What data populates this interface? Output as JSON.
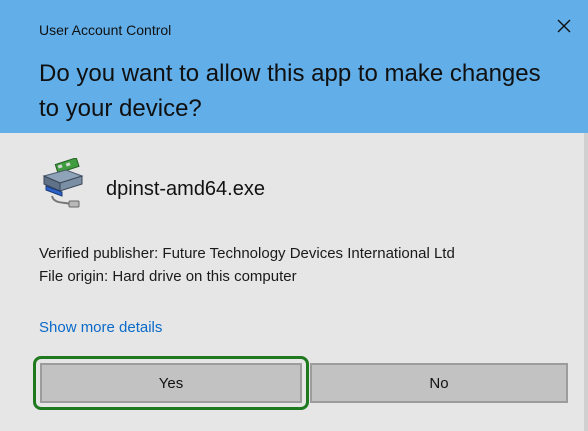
{
  "window": {
    "title": "User Account Control",
    "close_icon": "close-icon"
  },
  "prompt": {
    "text": "Do you want to allow this app to make changes to your device?"
  },
  "app": {
    "icon": "installer-icon",
    "name": "dpinst-amd64.exe"
  },
  "details": {
    "publisher": "Verified publisher: Future Technology Devices International Ltd",
    "origin": "File origin: Hard drive on this computer",
    "show_more": "Show more details"
  },
  "buttons": {
    "yes": "Yes",
    "no": "No"
  },
  "colors": {
    "header": "#61aee8",
    "body": "#e6e6e6",
    "link": "#0a6ac9",
    "focus_outline": "#1f7a1f",
    "button": "#c2c2c2"
  }
}
